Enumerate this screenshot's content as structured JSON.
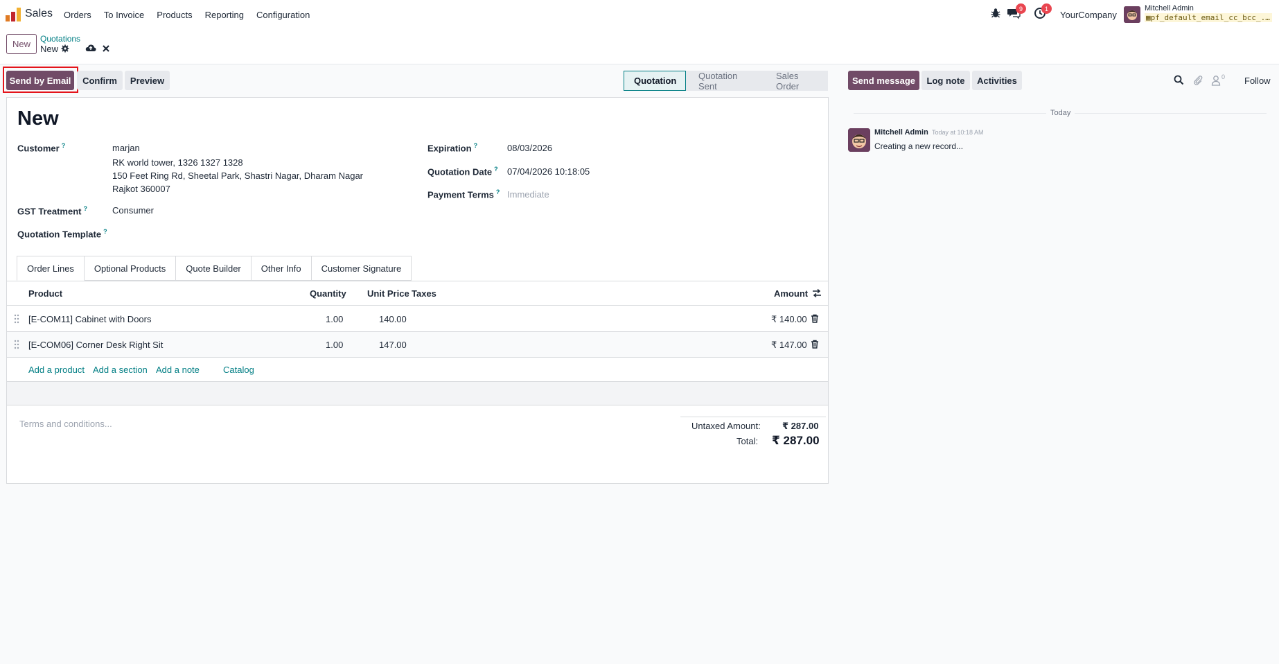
{
  "nav": {
    "app_name": "Sales",
    "menu": [
      "Orders",
      "To Invoice",
      "Products",
      "Reporting",
      "Configuration"
    ],
    "messages_badge": "9",
    "activities_badge": "1",
    "company": "YourCompany",
    "user_name": "Mitchell Admin",
    "user_db": "pf_default_email_cc_bcc_..."
  },
  "control_panel": {
    "new_label": "New",
    "breadcrumb_parent": "Quotations",
    "breadcrumb_current": "New"
  },
  "actions": {
    "send_email": "Send by Email",
    "confirm": "Confirm",
    "preview": "Preview"
  },
  "status": {
    "stages": [
      "Quotation",
      "Quotation Sent",
      "Sales Order"
    ],
    "active": "Quotation"
  },
  "form": {
    "title": "New",
    "customer_label": "Customer",
    "customer_name": "marjan",
    "customer_addr1": "RK world tower, 1326 1327 1328",
    "customer_addr2": "150 Feet Ring Rd, Sheetal Park, Shastri Nagar, Dharam Nagar",
    "customer_addr3": "Rajkot 360007",
    "gst_label": "GST Treatment",
    "gst_value": "Consumer",
    "template_label": "Quotation Template",
    "expiration_label": "Expiration",
    "expiration_value": "08/03/2026",
    "quotation_date_label": "Quotation Date",
    "quotation_date_value": "07/04/2026 10:18:05",
    "payment_terms_label": "Payment Terms",
    "payment_terms_placeholder": "Immediate",
    "help_mark": "?"
  },
  "tabs": [
    "Order Lines",
    "Optional Products",
    "Quote Builder",
    "Other Info",
    "Customer Signature"
  ],
  "table": {
    "headers": {
      "product": "Product",
      "quantity": "Quantity",
      "unit_price": "Unit Price",
      "taxes": "Taxes",
      "amount": "Amount"
    },
    "rows": [
      {
        "product": "[E-COM11] Cabinet with Doors",
        "quantity": "1.00",
        "unit_price": "140.00",
        "taxes": "",
        "amount": "₹ 140.00"
      },
      {
        "product": "[E-COM06] Corner Desk Right Sit",
        "quantity": "1.00",
        "unit_price": "147.00",
        "taxes": "",
        "amount": "₹ 147.00"
      }
    ],
    "add_product": "Add a product",
    "add_section": "Add a section",
    "add_note": "Add a note",
    "catalog": "Catalog"
  },
  "footer": {
    "terms_placeholder": "Terms and conditions...",
    "untaxed_label": "Untaxed Amount:",
    "untaxed_value": "₹ 287.00",
    "total_label": "Total:",
    "total_value": "₹ 287.00"
  },
  "chatter": {
    "send_message": "Send message",
    "log_note": "Log note",
    "activities": "Activities",
    "attachments_count": "0",
    "follow": "Follow",
    "today": "Today",
    "message_author": "Mitchell Admin",
    "message_time": "Today at 10:18 AM",
    "message_body": "Creating a new record..."
  },
  "colors": {
    "brand": "#714b67",
    "link": "#017e84",
    "focus": "#e4141b",
    "badge": "#e94650"
  }
}
